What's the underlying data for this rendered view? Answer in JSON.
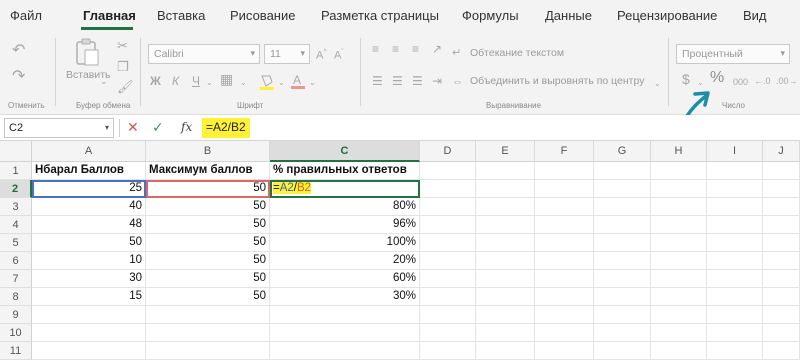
{
  "menu": {
    "tabs": [
      "Файл",
      "Главная",
      "Вставка",
      "Рисование",
      "Разметка страницы",
      "Формулы",
      "Данные",
      "Рецензирование",
      "Вид"
    ],
    "active": "Главная"
  },
  "ribbon": {
    "undo_group": "Отменить",
    "clipboard": {
      "paste": "Вставить",
      "group": "Буфер обмена"
    },
    "font": {
      "name": "Calibri",
      "size": "11",
      "bold": "Ж",
      "italic": "К",
      "underline": "Ч",
      "group": "Шрифт"
    },
    "alignment": {
      "wrap": "Обтекание текстом",
      "merge": "Объединить и выровнять по центру",
      "group": "Выравнивание"
    },
    "number": {
      "format": "Процентный",
      "currency": "$",
      "percent": "%",
      "thousands": "000",
      "group": "Число"
    }
  },
  "formula_bar": {
    "name_box": "C2",
    "formula": "=A2/B2"
  },
  "columns": [
    "A",
    "B",
    "C",
    "D",
    "E",
    "F",
    "G",
    "H",
    "I",
    "J"
  ],
  "rows": [
    "1",
    "2",
    "3",
    "4",
    "5",
    "6",
    "7",
    "8",
    "9",
    "10",
    "11"
  ],
  "headers": {
    "a": "Нбарал Баллов",
    "b": "Максимум баллов",
    "c": "% правильных ответов"
  },
  "data_rows": [
    {
      "a": "25",
      "b": "50",
      "c": ""
    },
    {
      "a": "40",
      "b": "50",
      "c": "80%"
    },
    {
      "a": "48",
      "b": "50",
      "c": "96%"
    },
    {
      "a": "50",
      "b": "50",
      "c": "100%"
    },
    {
      "a": "10",
      "b": "50",
      "c": "20%"
    },
    {
      "a": "30",
      "b": "50",
      "c": "60%"
    },
    {
      "a": "15",
      "b": "50",
      "c": "30%"
    }
  ],
  "editing": {
    "eq": "=",
    "ref_a": "A2",
    "slash": "/",
    "ref_b": "B2"
  },
  "accent_colors": {
    "excel_green": "#217346",
    "highlight": "#fff234",
    "arrow": "#1c8fa6"
  }
}
